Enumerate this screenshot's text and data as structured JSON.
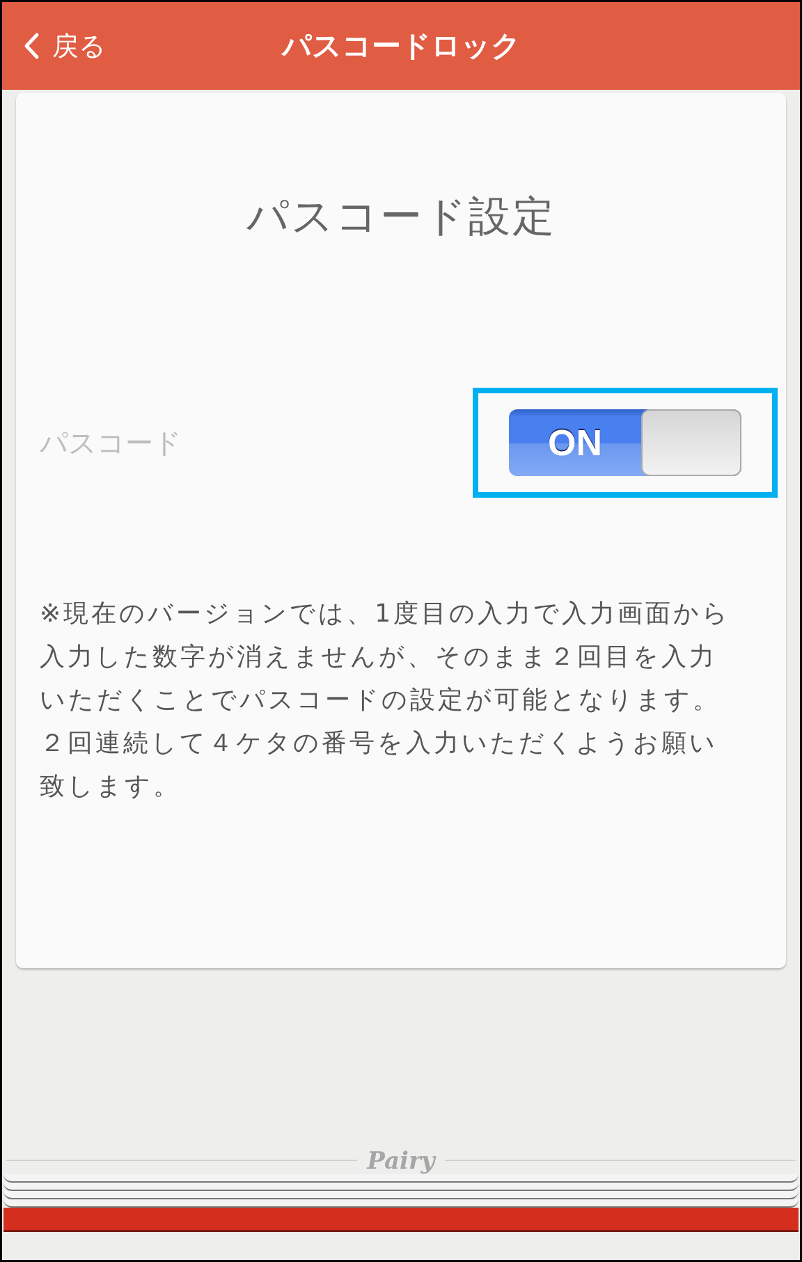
{
  "nav_bar": {
    "back_label": "戻る",
    "title": "パスコードロック"
  },
  "card": {
    "heading": "パスコード設定",
    "setting": {
      "label": "パスコード",
      "toggle_text": "ON",
      "on": true,
      "highlighted": true
    },
    "note": "※現在のバージョンでは、1度目の入力で入力画面から入力した数字が消えませんが、そのまま２回目を入力いただくことでパスコードの設定が可能となります。２回連続して４ケタの番号を入力いただくようお願い致します。"
  },
  "footer": {
    "brand": "Pairy"
  }
}
